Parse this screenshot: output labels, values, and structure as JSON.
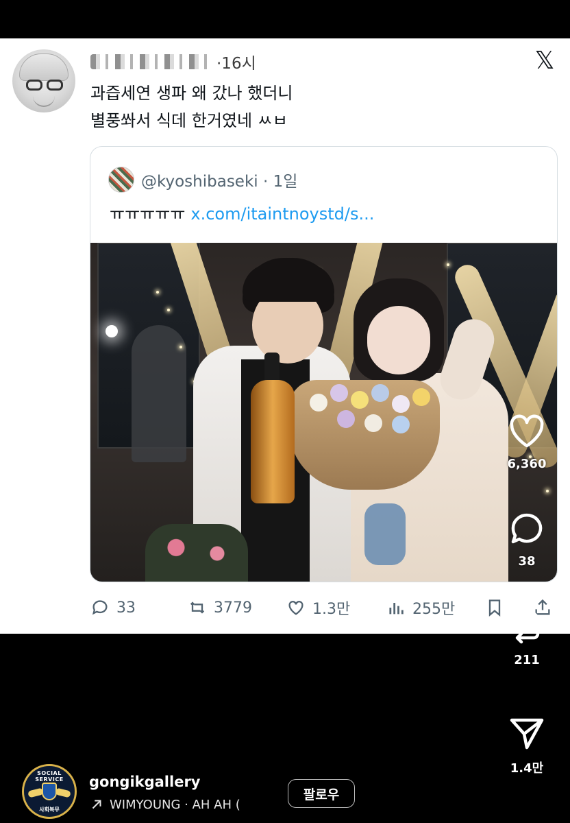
{
  "post": {
    "author_name": "",
    "time": "·16시",
    "text_lines": [
      "과즙세연 생파 왜 갔나 했더니",
      "별풍쏴서 식데 한거였네 ㅆㅂ"
    ],
    "x_logo": "𝕏"
  },
  "quote": {
    "handle": "@kyoshibaseki · 1일",
    "text": "ㅠㅠㅠㅠㅠ",
    "link": "x.com/itaintnoystd/s..."
  },
  "tweet_actions": {
    "replies": "33",
    "retweets": "3779",
    "likes": "1.3만",
    "views": "255만"
  },
  "reel_rail": {
    "likes": "6,360",
    "comments": "38",
    "reposts": "211",
    "shares": "1.4만"
  },
  "footer": {
    "account": "gongikgallery",
    "music": "WIMYOUNG · AH AH (",
    "follow_label": "팔로우",
    "badge_top": "SOCIAL SERVICE",
    "badge_bottom": "사회복무"
  },
  "colors": {
    "link": "#1d9bf0",
    "text_secondary": "#536471",
    "background": "#000000",
    "card": "#ffffff"
  },
  "icons": [
    "heart-icon",
    "comment-icon",
    "repost-icon",
    "send-icon",
    "reply-icon",
    "retweet-icon",
    "like-icon",
    "views-icon",
    "bookmark-icon",
    "share-icon",
    "music-arrow-icon"
  ]
}
